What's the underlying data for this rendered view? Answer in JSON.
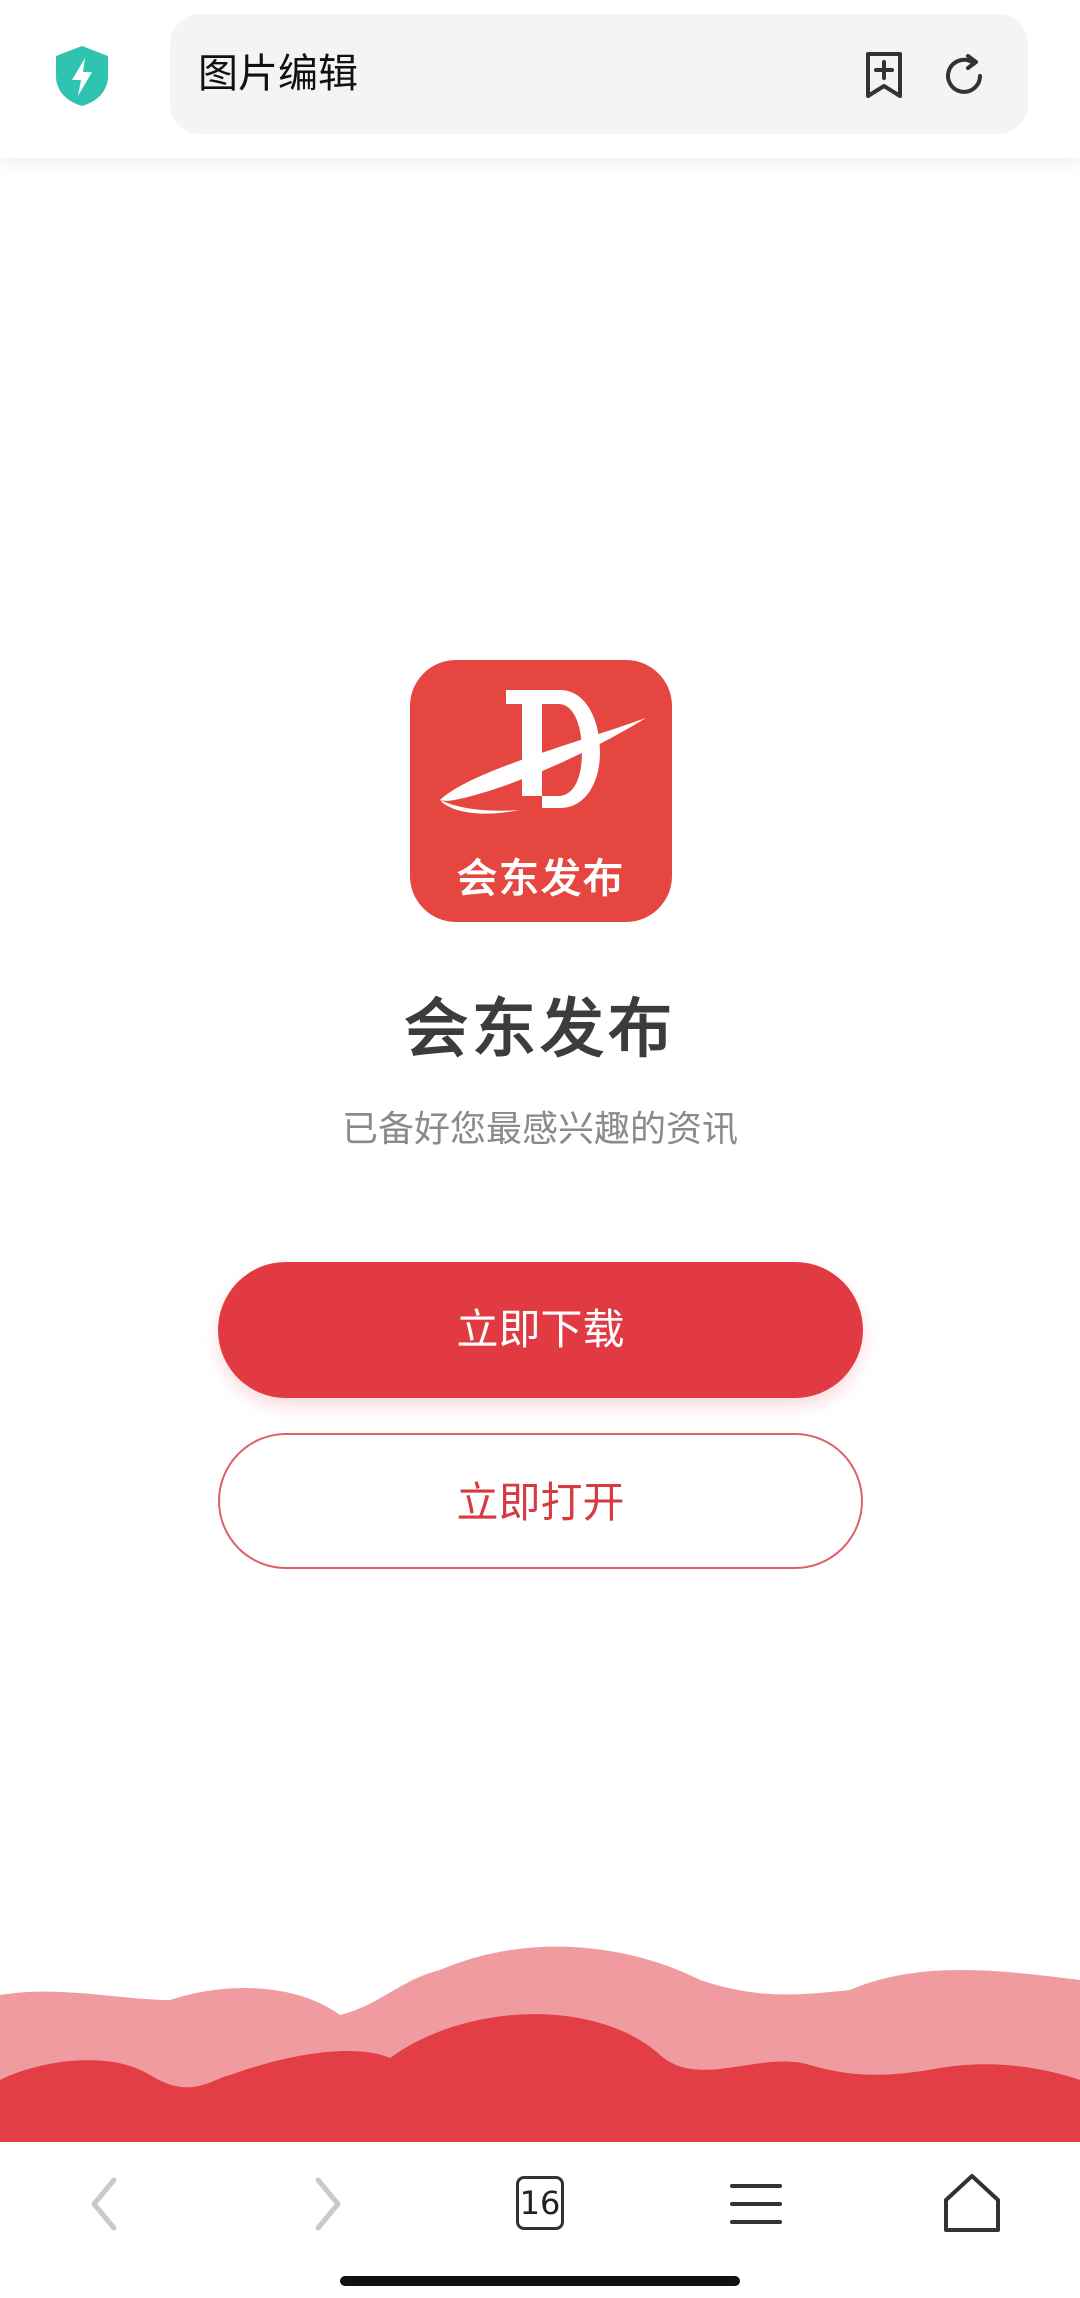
{
  "browser": {
    "address_text": "图片编辑",
    "tab_count": "16",
    "icons": {
      "security": "shield-bolt-icon",
      "bookmark": "bookmark-add-icon",
      "refresh": "refresh-icon",
      "back": "chevron-left-icon",
      "forward": "chevron-right-icon",
      "tabs": "tabs-icon",
      "menu": "menu-icon",
      "home": "home-icon"
    }
  },
  "app": {
    "logo_text": "会东发布",
    "name": "会东发布",
    "slogan": "已备好您最感兴趣的资讯"
  },
  "actions": {
    "download_label": "立即下载",
    "open_label": "立即打开"
  },
  "colors": {
    "brand_red": "#e23a42",
    "logo_red": "#e5463f",
    "hill_light": "#f09ba0",
    "hill_dark": "#e33d45",
    "shield_teal": "#2ec4b0"
  }
}
